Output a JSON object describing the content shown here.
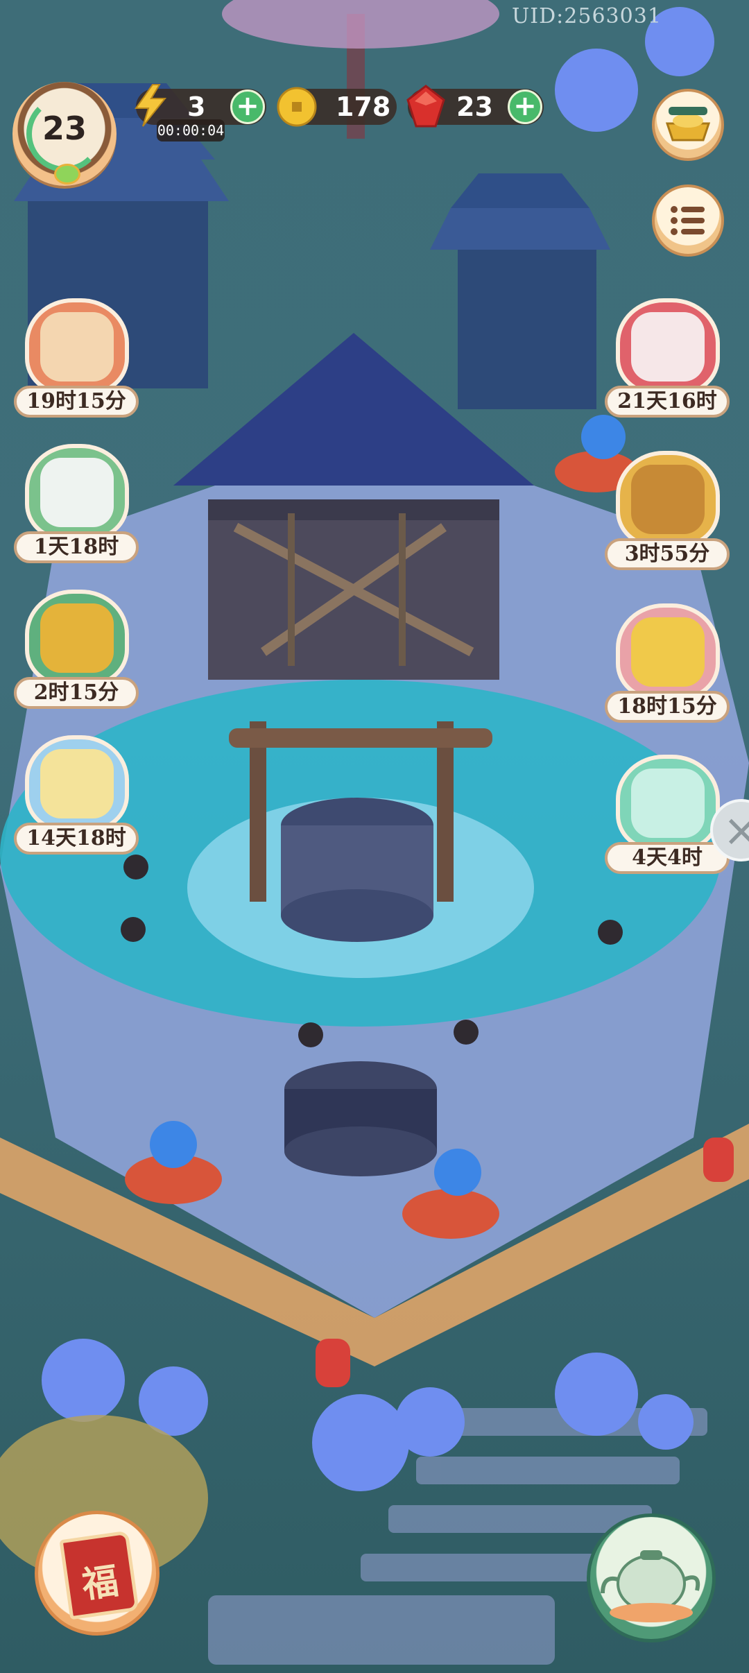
{
  "uid": "UID:2563031",
  "hud": {
    "level": "23",
    "energy": {
      "value": "3",
      "timer": "00:00:04"
    },
    "coins": {
      "value": "178"
    },
    "gems": {
      "value": "23"
    }
  },
  "events_left": [
    {
      "timer": "19时15分",
      "icon": "scroll-bundle-icon"
    },
    {
      "timer": "1天18时",
      "icon": "cockatoo-icon"
    },
    {
      "timer": "2时15分",
      "icon": "gold-shop-icon"
    },
    {
      "timer": "14天18时",
      "icon": "moon-rabbit-icon"
    }
  ],
  "events_right": [
    {
      "timer": "21天16时",
      "icon": "rabbit-event-icon"
    },
    {
      "timer": "3时55分",
      "icon": "treasure-box-icon"
    },
    {
      "timer": "18时15分",
      "icon": "coin-cards-icon"
    },
    {
      "timer": "4天4时",
      "icon": "gift-cat-icon"
    }
  ],
  "buttons": {
    "shop": "ingot-shop-icon",
    "menu": "list-menu-icon",
    "book": "book-icon",
    "close": "close-icon",
    "tea": "teapot-icon",
    "book_glyph": "福"
  },
  "colors": {
    "hud_bar": "#3a2c26",
    "plus_green": "#48b96a",
    "label_bg": "#fbf5ec",
    "label_border": "#c9a27e",
    "water": "#2db4c8"
  }
}
